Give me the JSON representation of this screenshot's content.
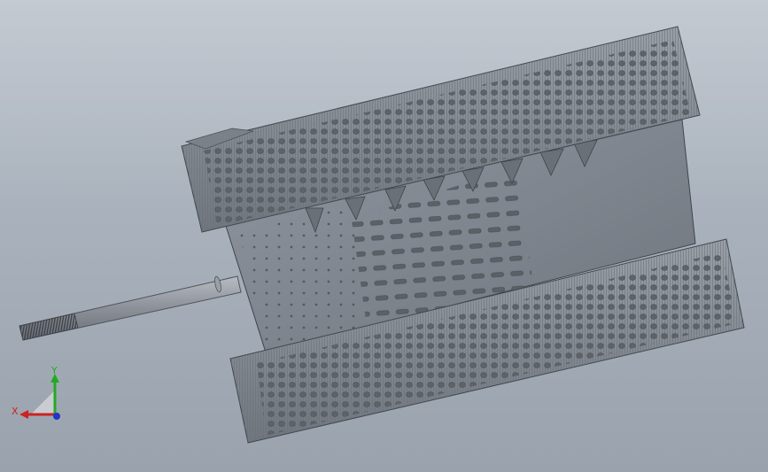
{
  "viewport": {
    "background_top": "#c4cad2",
    "background_bottom": "#9aa3ad"
  },
  "model": {
    "part": "cylindrical-roller-with-perforated-rims-and-threaded-shaft",
    "body_color": "#7f858d",
    "rim_color": "#8a9098",
    "hole_color": "#5e636a"
  },
  "triad": {
    "x_label": "X",
    "y_label": "Y",
    "x_color": "#cc2222",
    "y_color": "#22aa22",
    "z_color": "#2233cc"
  }
}
